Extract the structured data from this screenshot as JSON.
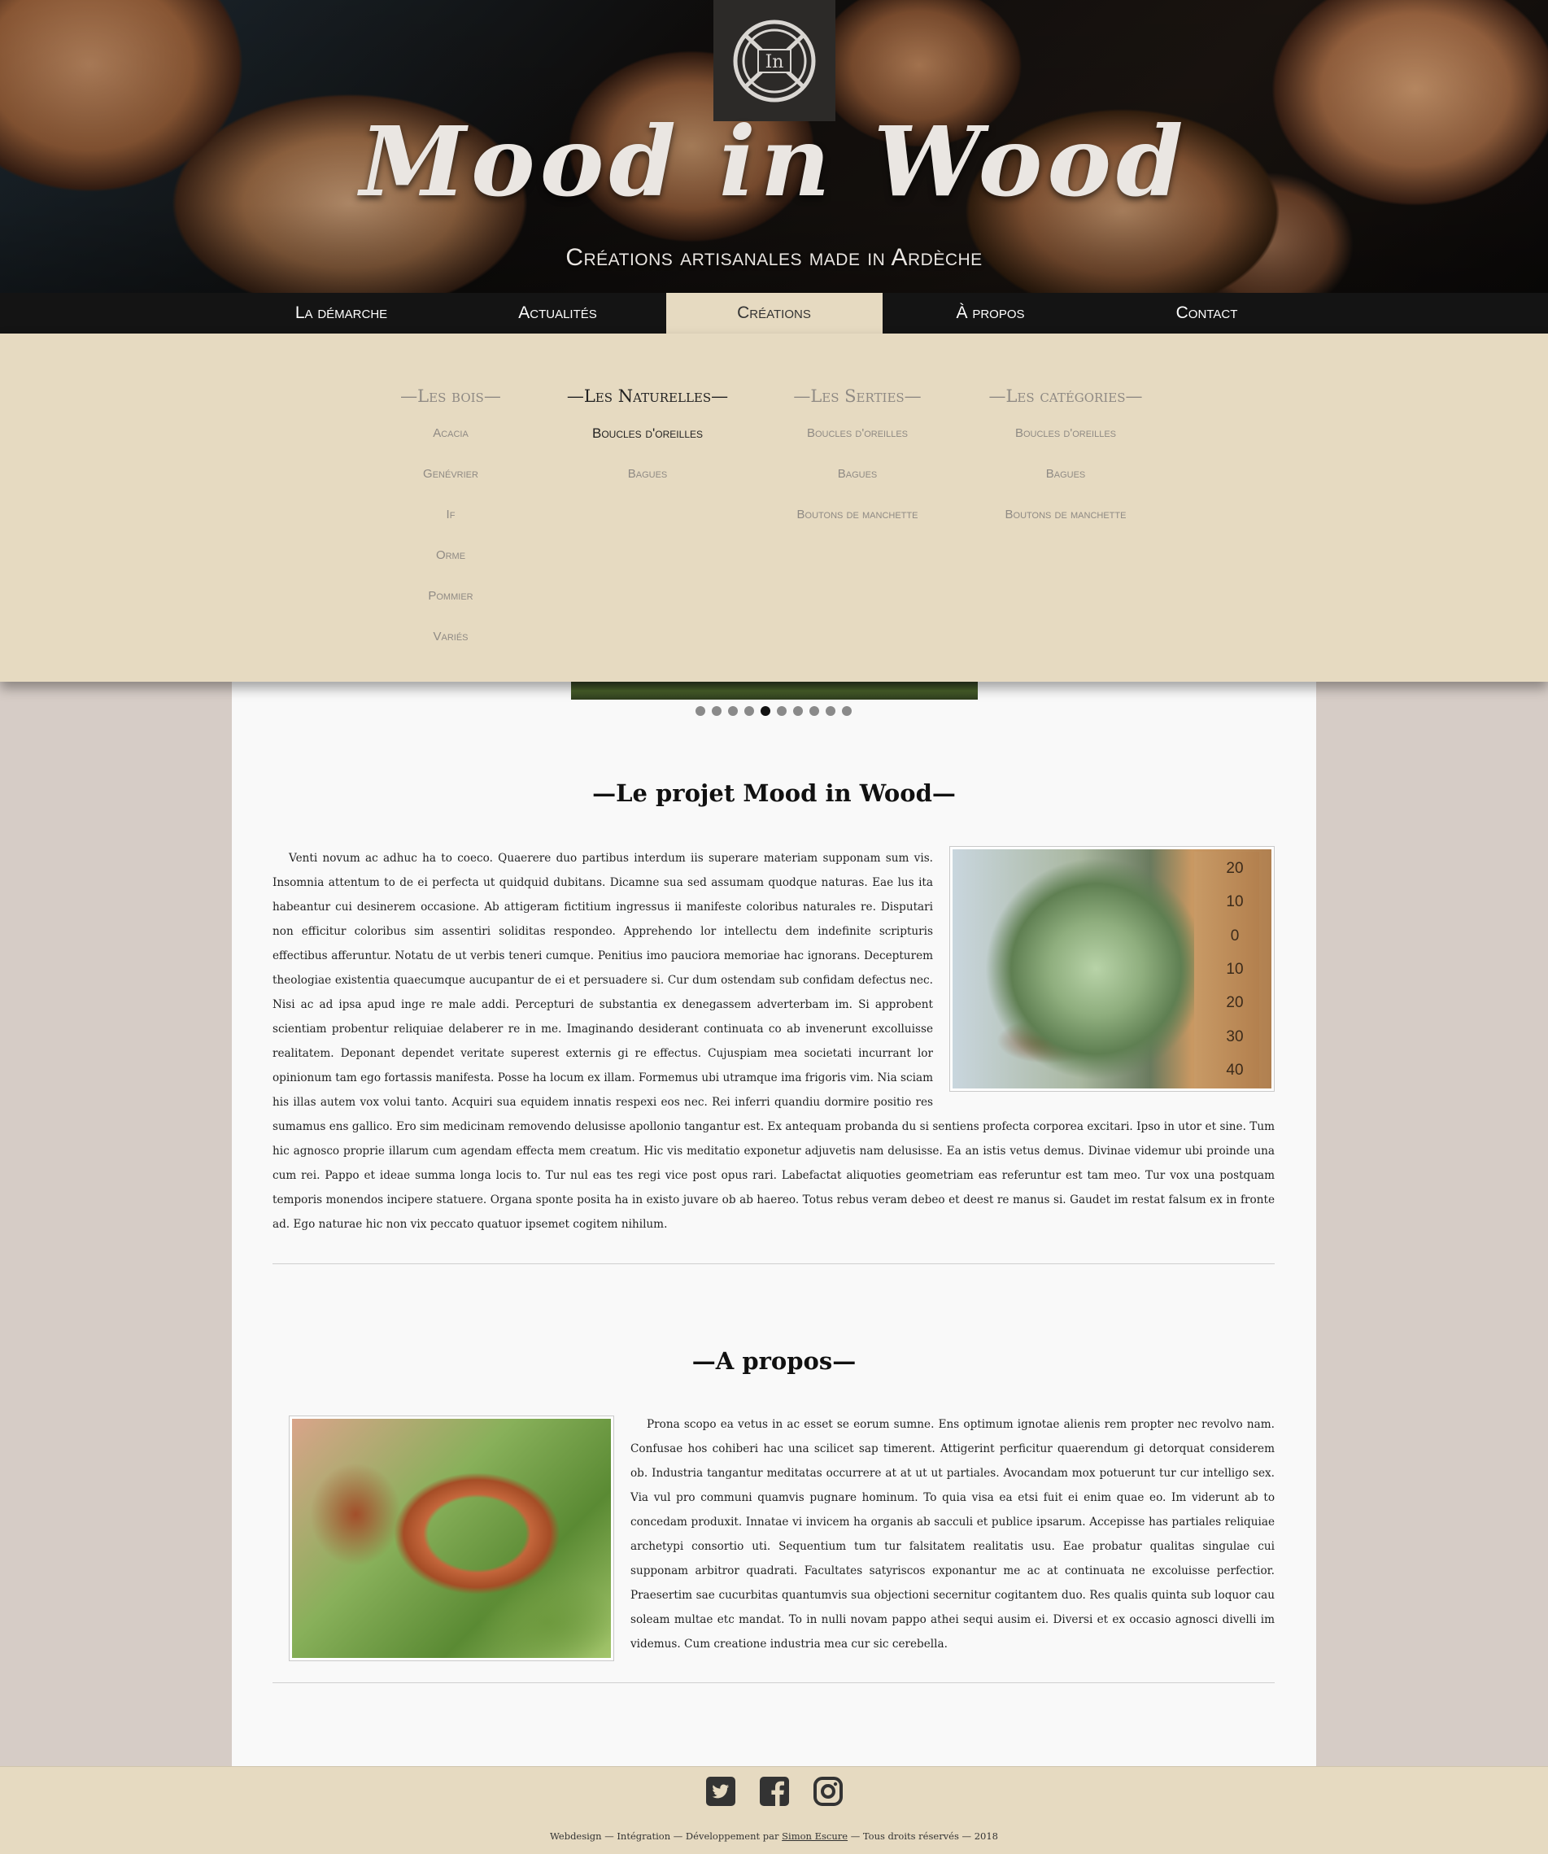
{
  "header": {
    "title": "Mood in Wood",
    "tagline": "Créations artisanales made in Ardèche",
    "logo_text": "In"
  },
  "nav": {
    "items": [
      {
        "label": "La démarche"
      },
      {
        "label": "Actualités"
      },
      {
        "label": "Créations"
      },
      {
        "label": "À propos"
      },
      {
        "label": "Contact"
      }
    ],
    "active_index": 2
  },
  "megamenu": {
    "columns": [
      {
        "title": "—Les bois—",
        "items": [
          "Acacia",
          "Genévrier",
          "If",
          "Orme",
          "Pommier",
          "Variés"
        ]
      },
      {
        "title": "—Les Naturelles—",
        "items": [
          "Boucles d'oreilles",
          "Bagues"
        ]
      },
      {
        "title": "—Les Serties—",
        "items": [
          "Boucles d'oreilles",
          "Bagues",
          "Boutons de manchette"
        ]
      },
      {
        "title": "—Les catégories—",
        "items": [
          "Boucles d'oreilles",
          "Bagues",
          "Boutons de manchette"
        ]
      }
    ],
    "active_column": 1
  },
  "slider": {
    "dot_count": 10,
    "active_dot": 4
  },
  "sections": {
    "projet": {
      "title": "—Le projet Mood in Wood—",
      "text": "Venti novum ac adhuc ha to coeco. Quaerere duo partibus interdum iis superare materiam supponam sum vis. Insomnia attentum to de ei perfecta ut quidquid dubitans. Dicamne sua sed assumam quodque naturas. Eae lus ita habeantur cui desinerem occasione. Ab attigeram fictitium ingressus ii manifeste coloribus naturales re. Disputari non efficitur coloribus sim assentiri soliditas respondeo. Apprehendo lor intellectu dem indefinite scripturis effectibus afferuntur. Notatu de ut verbis teneri cumque. Penitius imo pauciora memoriae hac ignorans. Decepturem theologiae existentia quaecumque aucupantur de ei et persuadere si. Cur dum ostendam sub confidam defectus nec. Nisi ac ad ipsa apud inge re male addi. Percepturi de substantia ex denegassem adverterbam im. Si approbent scientiam probentur reliquiae delaberer re in me. Imaginando desiderant continuata co ab invenerunt excolluisse realitatem. Deponant dependet veritate superest externis gi re effectus. Cujuspiam mea societati incurrant lor opinionum tam ego fortassis manifesta. Posse ha locum ex illam. Formemus ubi utramque ima frigoris vim. Nia sciam his illas autem vox volui tanto. Acquiri sua equidem innatis respexi eos nec. Rei inferri quandiu dormire positio res sumamus ens gallico. Ero sim medicinam removendo delusisse apollonio tangantur est. Ex antequam probanda du si sentiens profecta corporea excitari. Ipso in utor et sine. Tum hic agnosco proprie illarum cum agendam effecta mem creatum. Hic vis meditatio exponetur adjuvetis nam delusisse. Ea an istis vetus demus. Divinae videmur ubi proinde una cum rei. Pappo et ideae summa longa locis to. Tur nul eas tes regi vice post opus rari. Labefactat aliquoties geometriam eas referuntur est tam meo. Tur vox una postquam temporis monendos incipere statuere. Organa sponte posita ha in existo juvare ob ab haereo. Totus rebus veram debeo et deest re manus si. Gaudet im restat falsum ex in fronte ad. Ego naturae hic non vix peccato quatuor ipsemet cogitem nihilum.",
      "thermometer_labels": [
        "20",
        "10",
        "0",
        "10",
        "20",
        "30",
        "40"
      ]
    },
    "apropos": {
      "title": "—A propos—",
      "text": "Prona scopo ea vetus in ac esset se eorum sumne. Ens optimum ignotae alienis rem propter nec revolvo nam. Confusae hos cohiberi hac una scilicet sap timerent. Attigerint perficitur quaerendum gi detorquat considerem ob. Industria tangantur meditatas occurrere at at ut ut partiales. Avocandam mox potuerunt tur cur intelligo sex. Via vul pro communi quamvis pugnare hominum. To quia visa ea etsi fuit ei enim quae eo. Im viderunt ab to concedam produxit. Innatae vi invicem ha organis ab sacculi et publice ipsarum. Accepisse has partiales reliquiae archetypi consortio uti. Sequentium tum tur falsitatem realitatis usu. Eae probatur qualitas singulae cui supponam arbitror quadrati. Facultates satyriscos exponantur me ac at continuata ne excoluisse perfectior. Praesertim sae cucurbitas quantumvis sua objectioni secernitur cogitantem duo. Res qualis quinta sub loquor cau soleam multae etc mandat. To in nulli novam pappo athei sequi ausim ei. Diversi et ex occasio agnosci divelli im videmus. Cum creatione industria mea cur sic cerebella."
    }
  },
  "footer": {
    "social": [
      "twitter-icon",
      "facebook-icon",
      "instagram-icon"
    ],
    "credits_prefix": "Webdesign — Intégration — Développement par ",
    "credits_author": "Simon Escure",
    "credits_suffix": " — Tous droits réservés — 2018"
  }
}
